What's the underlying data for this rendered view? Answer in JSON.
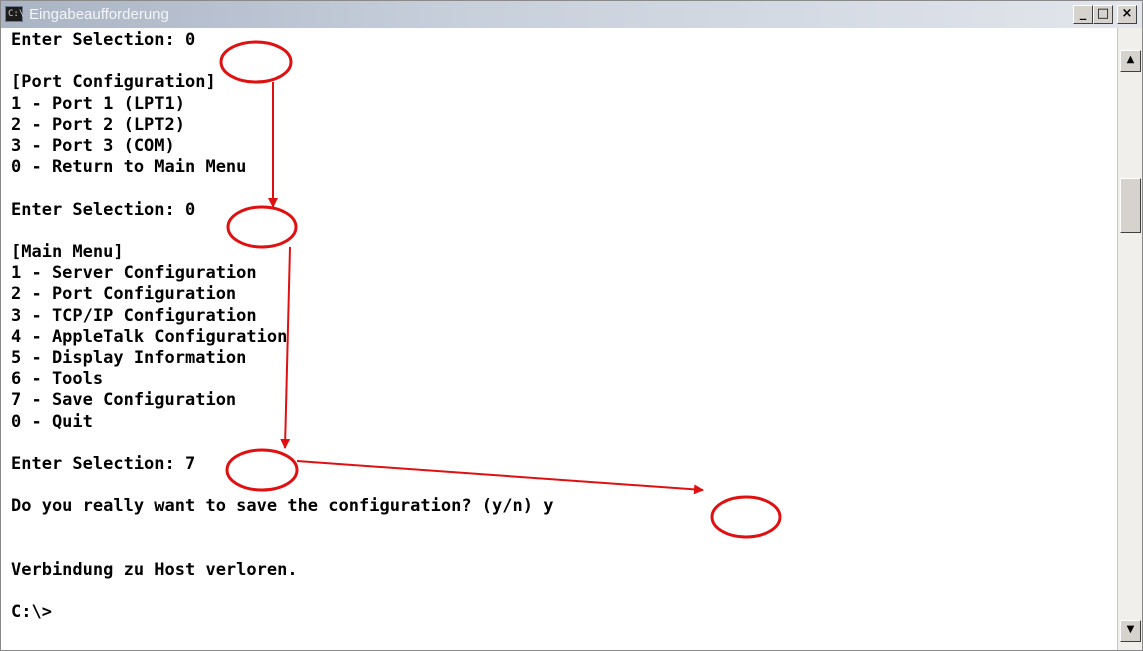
{
  "window": {
    "title": "Eingabeaufforderung",
    "icon": "console-icon",
    "icon_glyph": "C:\\",
    "controls": {
      "minimize": "_",
      "maximize": "□",
      "close": "×"
    }
  },
  "console": {
    "lines": [
      "Enter Selection: 0",
      "",
      "[Port Configuration]",
      "1 - Port 1 (LPT1)",
      "2 - Port 2 (LPT2)",
      "3 - Port 3 (COM)",
      "0 - Return to Main Menu",
      "",
      "Enter Selection: 0",
      "",
      "[Main Menu]",
      "1 - Server Configuration",
      "2 - Port Configuration",
      "3 - TCP/IP Configuration",
      "4 - AppleTalk Configuration",
      "5 - Display Information",
      "6 - Tools",
      "7 - Save Configuration",
      "0 - Quit",
      "",
      "Enter Selection: 7",
      "",
      "Do you really want to save the configuration? (y/n) y",
      "",
      "",
      "Verbindung zu Host verloren.",
      "",
      "C:\\>"
    ]
  },
  "scrollbar": {
    "up_glyph": "▲",
    "down_glyph": "▼"
  },
  "annotations": {
    "highlight_color": "#e01010"
  }
}
